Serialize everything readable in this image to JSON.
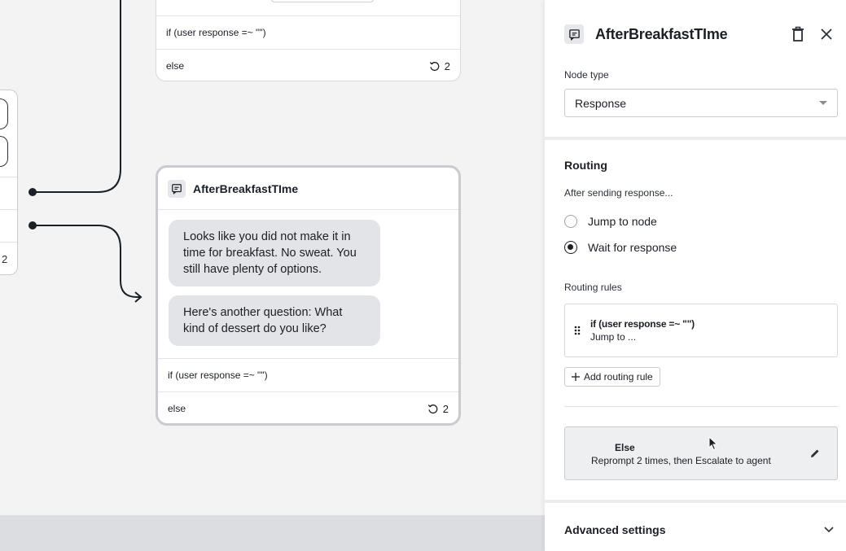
{
  "canvas": {
    "left_node": {
      "count": "2"
    },
    "top_node": {
      "rule_label": "if (user response =~ \"\")",
      "else_label": "else",
      "reprompt_count": "2"
    },
    "main_node": {
      "title": "AfterBreakfastTIme",
      "messages": [
        "Looks like you did not make it in time for breakfast. No sweat. You still have plenty of options.",
        "Here's another question: What kind of dessert do you like?"
      ],
      "rule_label": "if (user response =~ \"\")",
      "else_label": "else",
      "reprompt_count": "2"
    }
  },
  "panel": {
    "title": "AfterBreakfastTIme",
    "icons": {
      "node": "message-square-icon",
      "delete": "trash-icon",
      "close": "close-icon"
    },
    "node_type_label": "Node type",
    "node_type_value": "Response",
    "routing_title": "Routing",
    "after_sending_label": "After sending response...",
    "radio_options": [
      {
        "label": "Jump to node",
        "checked": false
      },
      {
        "label": "Wait for response",
        "checked": true
      }
    ],
    "routing_rules_label": "Routing rules",
    "rule": {
      "condition": "if (user response =~ \"\")",
      "destination": "Jump to ..."
    },
    "add_rule_label": "Add routing rule",
    "else": {
      "title": "Else",
      "description": "Reprompt 2 times, then Escalate to agent"
    },
    "advanced_label": "Advanced settings"
  },
  "colors": {
    "canvas_bg": "#f3f3f4",
    "ink": "#1b1f26",
    "bubble_bg": "#e3e4e7",
    "selected_border": "#c9cbd1"
  }
}
